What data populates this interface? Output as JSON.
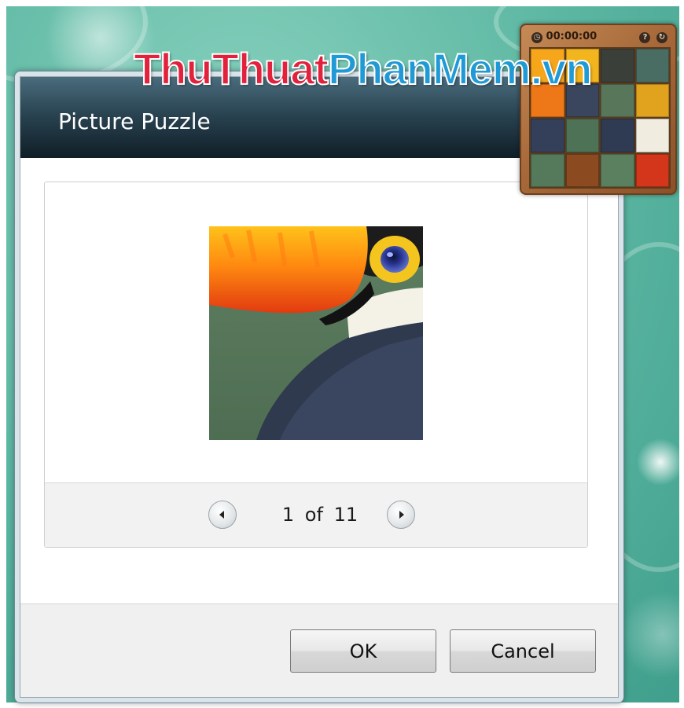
{
  "dialog": {
    "title": "Picture Puzzle",
    "pager": {
      "current": "1",
      "separator": "of",
      "total": "11"
    },
    "buttons": {
      "ok": "OK",
      "cancel": "Cancel"
    }
  },
  "gadget": {
    "timer": "00:00:00"
  },
  "watermark": {
    "part1": "ThuThuat",
    "part2": "PhanMem.vn"
  },
  "colors": {
    "title_bar": "#1b2f3a",
    "watermark_red": "#e2213c",
    "watermark_blue": "#1f9ad6",
    "gadget_wood": "#a86a3a"
  },
  "icons": [
    "clock-icon",
    "help-icon",
    "shuffle-icon",
    "previous-arrow-icon",
    "next-arrow-icon"
  ]
}
